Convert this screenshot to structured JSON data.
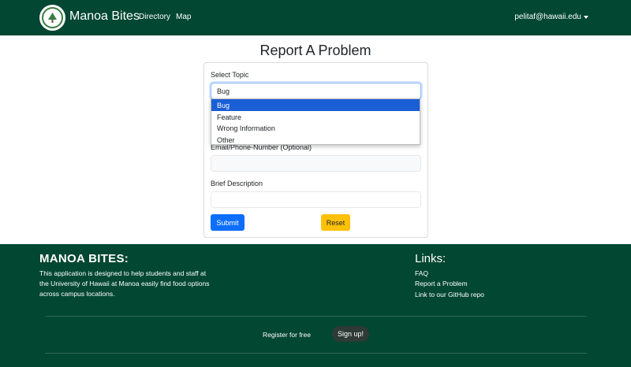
{
  "navbar": {
    "brand": "Manoa Bites",
    "links": [
      "Directory",
      "Map"
    ],
    "user_email": "pelitaf@hawaii.edu",
    "logo_icon": "manoa-bites-logo-icon"
  },
  "main": {
    "title": "Report A Problem",
    "form": {
      "topic_label": "Select Topic",
      "topic_value": "Bug",
      "topic_options": [
        "Bug",
        "Feature",
        "Wrong Information",
        "Other"
      ],
      "email_label": "Email/Phone-Number (Optional)",
      "email_value": "",
      "description_label": "Brief Description",
      "description_value": "",
      "submit_label": "Submit",
      "reset_label": "Reset"
    }
  },
  "footer": {
    "title": "MANOA BITES:",
    "description": "This application is designed to help students and staff at the University of Hawaii at Manoa easily find food options across campus locations.",
    "links_title": "Links:",
    "links": [
      "FAQ",
      "Report a Problem",
      "Link to our GitHub repo"
    ],
    "register_text": "Register for free",
    "signup_label": "Sign up!"
  },
  "colors": {
    "brand_green": "#024731",
    "primary": "#0d6efd",
    "warning": "#ffc107",
    "selected_option": "#1a5fd6"
  }
}
